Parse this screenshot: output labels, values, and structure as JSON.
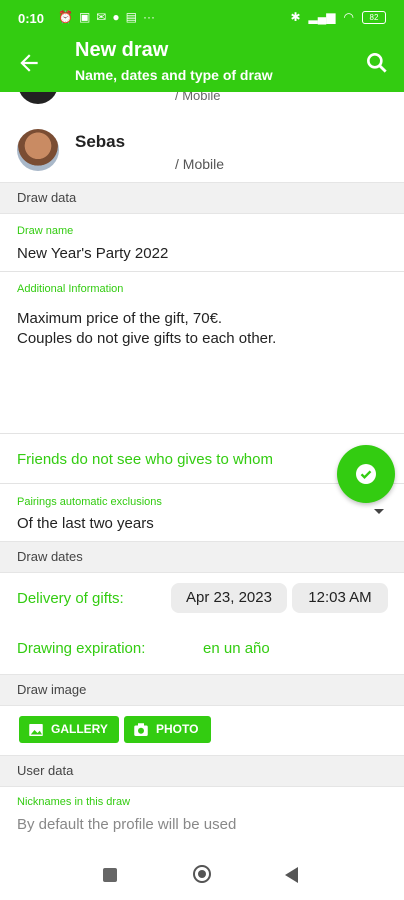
{
  "status": {
    "time": "0:10",
    "left_icons": [
      "alarm-icon",
      "calendar-icon",
      "mail-icon",
      "github-icon",
      "notification-icon",
      "more-icon"
    ],
    "right_icons": [
      "bluetooth-icon",
      "signal-icon",
      "wifi-icon",
      "battery-icon"
    ],
    "battery_level": "82"
  },
  "appbar": {
    "title": "New draw",
    "subtitle": "Name, dates and type of draw",
    "back_icon": "arrow-left-icon",
    "search_icon": "search-icon",
    "color": "#33cc11"
  },
  "contacts": {
    "previous_type": "/ Mobile",
    "name": "Sebas",
    "type": "/ Mobile"
  },
  "draw_data": {
    "header": "Draw data",
    "name_label": "Draw name",
    "name_value": "New Year's Party 2022",
    "info_label": "Additional Information",
    "info_line1": "Maximum price of the gift, 70€.",
    "info_line2": "Couples do not give gifts to each other.",
    "friends_toggle": "Friends do not see who gives to whom",
    "exclusions_label": "Pairings automatic exclusions",
    "exclusions_value": "Of the last two years"
  },
  "draw_dates": {
    "header": "Draw dates",
    "delivery_label": "Delivery of gifts:",
    "delivery_date": "Apr 23, 2023",
    "delivery_time": "12:03 AM",
    "expiration_label": "Drawing expiration:",
    "expiration_value": "en un año"
  },
  "draw_image": {
    "header": "Draw image",
    "gallery_label": "GALLERY",
    "photo_label": "PHOTO"
  },
  "user_data": {
    "header": "User data",
    "nicknames_label": "Nicknames in this draw",
    "nicknames_placeholder": "By default the profile will be used"
  },
  "fab_icon": "check-icon"
}
